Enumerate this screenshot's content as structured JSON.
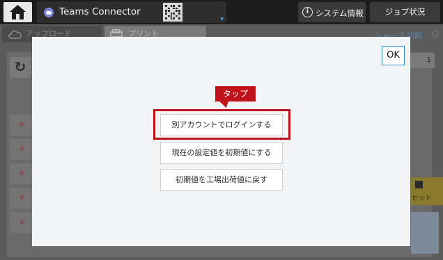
{
  "topbar": {
    "app_title": "Teams Connector",
    "system_info_label": "システム情報",
    "job_status_label": "ジョブ状況"
  },
  "background": {
    "upload_tab": "アップロード",
    "print_tab": "プリント",
    "sharp_label": "シャープ 初期",
    "counter_value": "1",
    "reset_label": "セット"
  },
  "dialog": {
    "ok_label": "OK",
    "callout_label": "タップ",
    "buttons": [
      {
        "label": "別アカウントでログインする"
      },
      {
        "label": "現在の設定値を初期値にする"
      },
      {
        "label": "初期値を工場出荷値に戻す"
      }
    ]
  },
  "colors": {
    "highlight": "#c0121a",
    "accent": "#2c8fd6"
  }
}
